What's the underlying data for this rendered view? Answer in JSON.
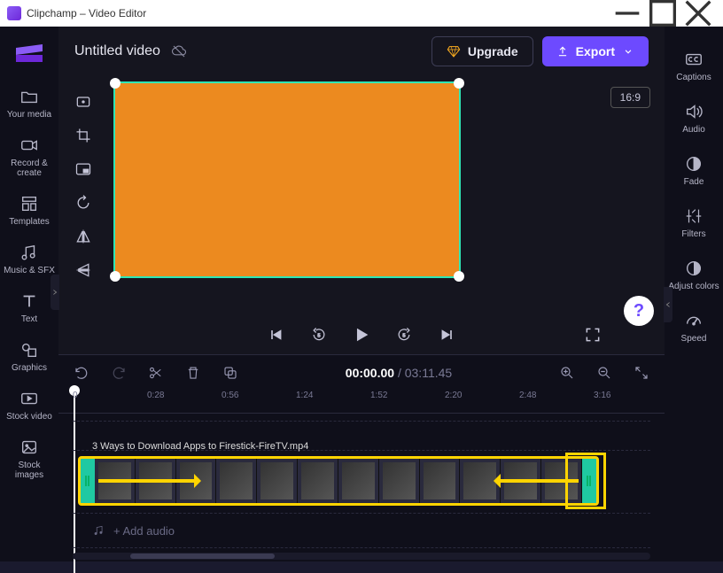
{
  "titlebar": {
    "title": "Clipchamp – Video Editor"
  },
  "project": {
    "title": "Untitled video"
  },
  "topbar": {
    "upgrade": "Upgrade",
    "export": "Export"
  },
  "aspect": "16:9",
  "sidebar_left": [
    {
      "label": "Your media",
      "icon": "folder"
    },
    {
      "label": "Record & create",
      "icon": "camera"
    },
    {
      "label": "Templates",
      "icon": "templates"
    },
    {
      "label": "Music & SFX",
      "icon": "music"
    },
    {
      "label": "Text",
      "icon": "text"
    },
    {
      "label": "Graphics",
      "icon": "graphics"
    },
    {
      "label": "Stock video",
      "icon": "stock-video"
    },
    {
      "label": "Stock images",
      "icon": "stock-images"
    }
  ],
  "sidebar_right": [
    {
      "label": "Captions",
      "icon": "captions"
    },
    {
      "label": "Audio",
      "icon": "audio"
    },
    {
      "label": "Fade",
      "icon": "fade"
    },
    {
      "label": "Filters",
      "icon": "filters"
    },
    {
      "label": "Adjust colors",
      "icon": "adjust"
    },
    {
      "label": "Speed",
      "icon": "speed"
    }
  ],
  "preview_tools": [
    "fit",
    "crop",
    "pip",
    "rotate",
    "flip-h",
    "flip-v"
  ],
  "playback": {
    "current": "00:00.00",
    "duration": "03:11.45"
  },
  "ruler": [
    "0",
    "0:28",
    "0:56",
    "1:24",
    "1:52",
    "2:20",
    "2:48",
    "3:16"
  ],
  "clip": {
    "filename": "3 Ways to Download Apps to Firestick-FireTV.mp4"
  },
  "add_audio": "+  Add audio"
}
